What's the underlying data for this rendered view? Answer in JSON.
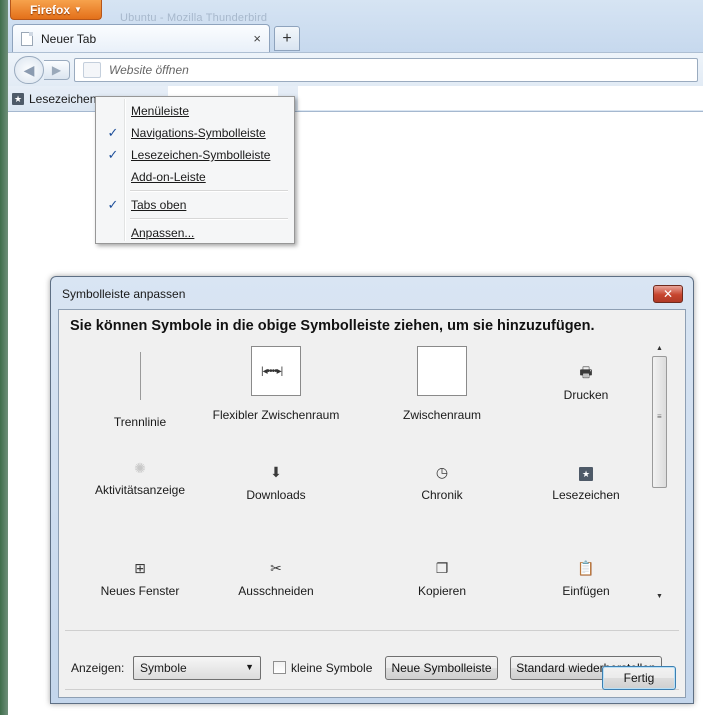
{
  "browser": {
    "firefox_button_label": "Firefox",
    "title_ghost": "Ubuntu - Mozilla Thunderbird",
    "tab_label": "Neuer Tab",
    "tab_close": "×",
    "new_tab": "+",
    "url_placeholder": "Website öffnen",
    "bookmarks_label": "Lesezeichen"
  },
  "context_menu": {
    "items": [
      {
        "label": "Menüleiste",
        "checked": false
      },
      {
        "label": "Navigations-Symbolleiste",
        "checked": true
      },
      {
        "label": "Lesezeichen-Symbolleiste",
        "checked": true
      },
      {
        "label": "Add-on-Leiste",
        "checked": false
      },
      {
        "label": "Tabs oben",
        "checked": true
      },
      {
        "label": "Anpassen...",
        "checked": false
      }
    ],
    "check_glyph": "✓"
  },
  "dialog": {
    "title": "Symbolleiste anpassen",
    "close": "✕",
    "heading": "Sie können Symbole in die obige Symbolleiste ziehen, um sie hinzuzufügen.",
    "palette": [
      {
        "label": "Trennlinie",
        "icon": "separator"
      },
      {
        "label": "Flexibler Zwischenraum",
        "icon": "flexible-space"
      },
      {
        "label": "Zwischenraum",
        "icon": "space"
      },
      {
        "label": "Drucken",
        "icon": "print-icon"
      },
      {
        "label": "Aktivitätsanzeige",
        "icon": "throbber-icon"
      },
      {
        "label": "Downloads",
        "icon": "download-icon"
      },
      {
        "label": "Chronik",
        "icon": "history-icon"
      },
      {
        "label": "Lesezeichen",
        "icon": "bookmark-icon"
      },
      {
        "label": "Neues Fenster",
        "icon": "new-window-icon"
      },
      {
        "label": "Ausschneiden",
        "icon": "cut-icon"
      },
      {
        "label": "Kopieren",
        "icon": "copy-icon"
      },
      {
        "label": "Einfügen",
        "icon": "paste-icon"
      }
    ],
    "show_label": "Anzeigen:",
    "show_value": "Symbole",
    "small_icons_label": "kleine Symbole",
    "small_icons_checked": false,
    "new_toolbar_label": "Neue Symbolleiste",
    "restore_default_label": "Standard wiederherstellen",
    "done_label": "Fertig"
  }
}
